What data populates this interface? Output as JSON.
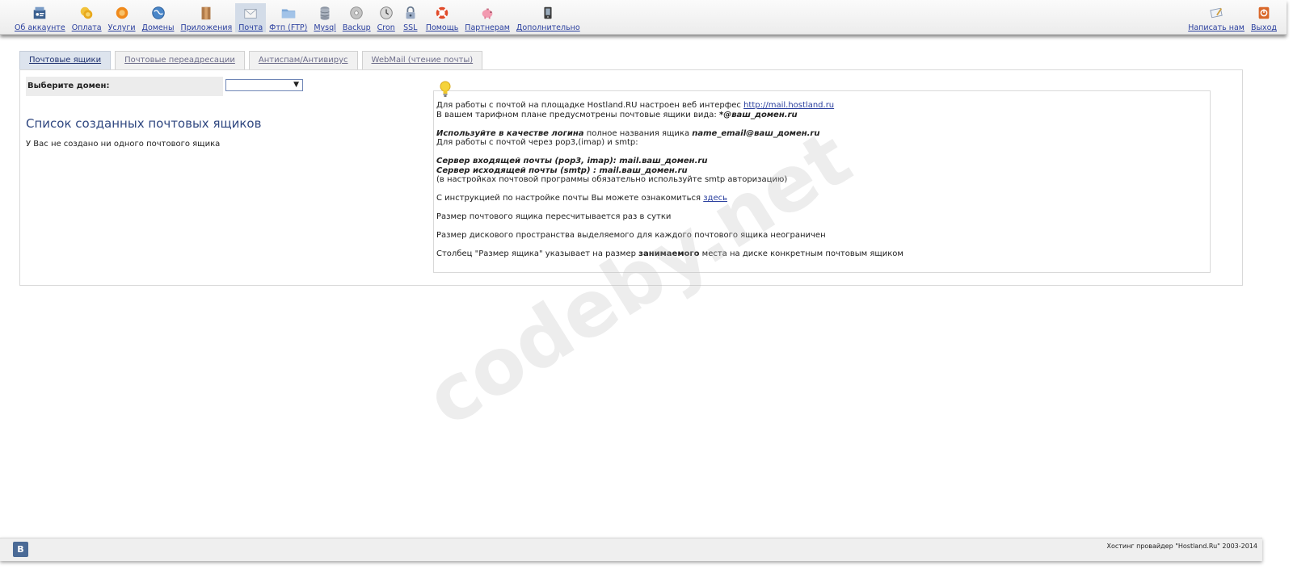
{
  "topnav": {
    "items": [
      {
        "label": "Об аккаунте",
        "icon": "account-icon"
      },
      {
        "label": "Оплата",
        "icon": "coins-icon"
      },
      {
        "label": "Услуги",
        "icon": "services-icon"
      },
      {
        "label": "Домены",
        "icon": "globe-icon"
      },
      {
        "label": "Приложения",
        "icon": "apps-icon"
      },
      {
        "label": "Почта",
        "icon": "mail-icon",
        "active": true
      },
      {
        "label": "Фтп (FTP)",
        "icon": "folder-icon"
      },
      {
        "label": "Mysql",
        "icon": "database-icon"
      },
      {
        "label": "Backup",
        "icon": "disc-icon"
      },
      {
        "label": "Cron",
        "icon": "clock-icon"
      },
      {
        "label": "SSL",
        "icon": "lock-icon"
      },
      {
        "label": "Помощь",
        "icon": "lifebuoy-icon"
      },
      {
        "label": "Партнерам",
        "icon": "piggy-bank-icon"
      },
      {
        "label": "Дополнительно",
        "icon": "device-icon"
      }
    ],
    "right_items": [
      {
        "label": "Написать нам",
        "icon": "write-icon"
      },
      {
        "label": "Выход",
        "icon": "exit-icon"
      }
    ]
  },
  "tabs": [
    {
      "label": "Почтовые ящики",
      "active": true
    },
    {
      "label": "Почтовые переадресации"
    },
    {
      "label": "Антиспам/Антивирус"
    },
    {
      "label": "WebMail (чтение почты)"
    }
  ],
  "domain": {
    "label": "Выберите домен:",
    "selected": ""
  },
  "mailboxes": {
    "title": "Список созданных почтовых ящиков",
    "empty_text": "У Вас не создано ни одного почтового ящика"
  },
  "info": {
    "line1_prefix": "Для работы с почтой на площадке Hostland.RU настроен веб интерфес ",
    "line1_link": "http://mail.hostland.ru",
    "line2_prefix": "В вашем тарифном плане предусмотрены почтовые ящики вида: ",
    "line2_bold": "*@ваш_домен.ru",
    "line3_bold": "Используйте в качестве логина",
    "line3_mid": " полное названия ящика ",
    "line3_bold2": "name_email@ваш_домен.ru",
    "line4": "Для работы с почтой через pop3,(imap) и smtp:",
    "line5": "Сервер входящей почты (pop3, imap): mail.ваш_домен.ru",
    "line6": "Сервер исходящей почты (smtp) : mail.ваш_домен.ru",
    "line7": "(в настройках почтовой программы обязательно используйте smtp авторизацию)",
    "line8_prefix": "С инструкцией по настройке почты Вы можете ознакомиться ",
    "line8_link": "здесь",
    "line9": "Размер почтового ящика пересчитывается раз в сутки",
    "line10": "Размер дискового пространства выделяемого для каждого почтового ящика неограничен",
    "line11_prefix": "Столбец \"Размер ящика\" указывает на размер ",
    "line11_bold": "занимаемого",
    "line11_suffix": " места на диске конкретным почтовым ящиком"
  },
  "watermark": "codeby.net",
  "footer": {
    "vk_label": "В",
    "copyright": "Хостинг провайдер \"Hostland.Ru\" 2003-2014"
  },
  "colors": {
    "link": "#2a3f9e",
    "title": "#2f4780",
    "active_tab": "#dde4ee"
  }
}
